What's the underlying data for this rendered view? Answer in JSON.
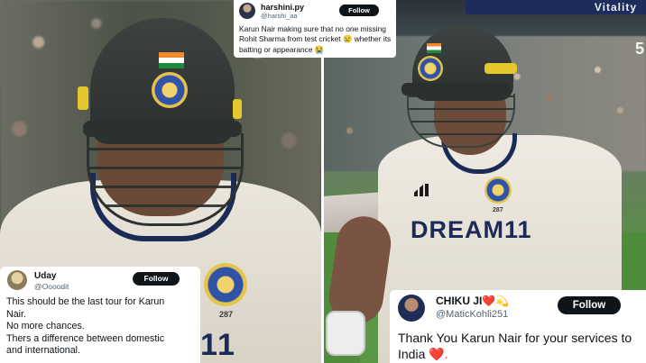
{
  "images": {
    "left_photo": {
      "jersey_number": "11",
      "cap_number": "287"
    },
    "right_photo": {
      "jersey_sponsor": "DREAM11",
      "cap_number": "287",
      "scoreboard_number": "5",
      "sponsor_board_text": "Vitality"
    }
  },
  "tweets": [
    {
      "name": "harshini.py",
      "handle": "@harshi_aa",
      "follow_label": "Follow",
      "text": "Karun Nair making sure that no one missing Rohit Sharma from test cricket 😢 whether its batting or appearance 😭"
    },
    {
      "name": "Uday",
      "handle": "@Oooodit",
      "follow_label": "Follow",
      "text_lines": [
        "This should be the last tour for Karun",
        "Nair.",
        "No more chances.",
        "Thers a difference between domestic",
        "and international."
      ]
    },
    {
      "name": "CHIKU JI",
      "name_emoji": "❤️💫",
      "handle": "@MaticKohli251",
      "follow_label": "Follow",
      "text": "Thank You Karun Nair for your services to India",
      "text_emoji": "❤️."
    }
  ],
  "colors": {
    "follow_button": "#0f1419",
    "handle_text": "#536471",
    "jersey_navy": "#1c2a57"
  }
}
